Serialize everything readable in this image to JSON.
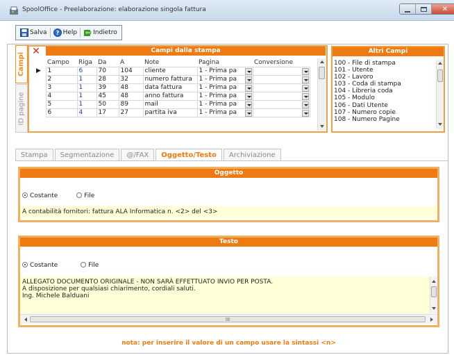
{
  "window": {
    "title": "SpoolOffice - Preelaborazione: elaborazione singola fattura"
  },
  "toolbar": {
    "save": "Salva",
    "help": "Help",
    "back": "Indietro"
  },
  "vertical_tabs": {
    "campi": "Campi",
    "id_pagine": "ID pagine"
  },
  "grid": {
    "header": "Campi dalla stampa",
    "columns": [
      "Campo",
      "Riga",
      "Da",
      "A",
      "Note",
      "Pagina",
      "Conversione"
    ],
    "rows": [
      {
        "campo": "1",
        "riga": "6",
        "da": "70",
        "a": "104",
        "note": "cliente",
        "pagina": "1 - Prima pa"
      },
      {
        "campo": "2",
        "riga": "1",
        "da": "28",
        "a": "32",
        "note": "numero fattura",
        "pagina": "1 - Prima pa"
      },
      {
        "campo": "3",
        "riga": "1",
        "da": "39",
        "a": "48",
        "note": "data fattura",
        "pagina": "1 - Prima pa"
      },
      {
        "campo": "4",
        "riga": "1",
        "da": "45",
        "a": "48",
        "note": "anno fattura",
        "pagina": "1 - Prima pa"
      },
      {
        "campo": "5",
        "riga": "1",
        "da": "50",
        "a": "89",
        "note": "mail",
        "pagina": "1 - Prima pa"
      },
      {
        "campo": "6",
        "riga": "4",
        "da": "17",
        "a": "27",
        "note": "partita iva",
        "pagina": "1 - Prima pa"
      }
    ]
  },
  "altri_campi": {
    "header": "Altri Campi",
    "items": [
      "100 - File di stampa",
      "101 - Utente",
      "102 - Lavoro",
      "103 - Coda di stampa",
      "104 - Libreria coda",
      "105 - Modulo",
      "106 - Dati Utente",
      "107 - Numero copie",
      "108 - Numero Pagine"
    ]
  },
  "tabs": [
    "Stampa",
    "Segmentazione",
    "@/FAX",
    "Oggetto/Testo",
    "Archiviazione"
  ],
  "active_tab": "Oggetto/Testo",
  "oggetto": {
    "header": "Oggetto",
    "option_costante": "Costante",
    "option_file": "File",
    "selected": "Costante",
    "value": "A contabilità fornitori: fattura ALA Informatica n. <2> del <3>"
  },
  "testo": {
    "header": "Testo",
    "option_costante": "Costante",
    "option_file": "File",
    "selected": "Costante",
    "lines": [
      "ALLEGATO DOCUMENTO ORIGINALE - NON SARÀ EFFETTUATO INVIO PER POSTA.",
      "A disposizione per qualsiasi chiarimento, cordiali saluti.",
      "Ing. Michele Balduani"
    ],
    "hscroll_label": "III"
  },
  "footer_note": "nota: per inserire il valore di un campo usare la sintassi <n>",
  "colors": {
    "accent": "#ef7a12",
    "panel_border": "#f0b060",
    "field_bg": "#ffffd8"
  }
}
